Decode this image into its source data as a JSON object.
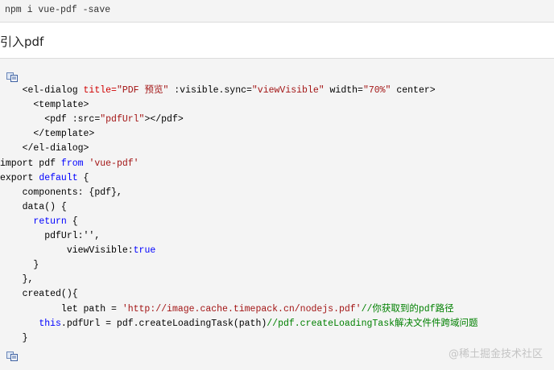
{
  "install": {
    "command": "npm i vue-pdf -save"
  },
  "heading": "引入pdf",
  "code": {
    "copy_icon_top": "copy-code-icon",
    "copy_icon_bottom": "copy-code-icon",
    "lines": [
      [
        {
          "t": "    <el-dialog "
        },
        {
          "t": "title=",
          "c": "attr"
        },
        {
          "t": "\"PDF 预览\"",
          "c": "str"
        },
        {
          "t": " :visible.sync="
        },
        {
          "t": "\"viewVisible\"",
          "c": "str"
        },
        {
          "t": " width="
        },
        {
          "t": "\"70%\"",
          "c": "str"
        },
        {
          "t": " center>"
        }
      ],
      [
        {
          "t": "      <template>"
        }
      ],
      [
        {
          "t": "        <pdf :src="
        },
        {
          "t": "\"pdfUrl\"",
          "c": "str"
        },
        {
          "t": "></pdf>"
        }
      ],
      [
        {
          "t": "      </template>"
        }
      ],
      [
        {
          "t": "    </el-dialog>"
        }
      ],
      [
        {
          "t": "import pdf "
        },
        {
          "t": "from",
          "c": "kw"
        },
        {
          "t": " "
        },
        {
          "t": "'vue-pdf'",
          "c": "str"
        }
      ],
      [
        {
          "t": "export "
        },
        {
          "t": "default",
          "c": "kw"
        },
        {
          "t": " {"
        }
      ],
      [
        {
          "t": "    components: {pdf},"
        }
      ],
      [
        {
          "t": "    data() {"
        }
      ],
      [
        {
          "t": "      "
        },
        {
          "t": "return",
          "c": "kw"
        },
        {
          "t": " {"
        }
      ],
      [
        {
          "t": "        pdfUrl:'',"
        }
      ],
      [
        {
          "t": "            viewVisible:"
        },
        {
          "t": "true",
          "c": "kw"
        }
      ],
      [
        {
          "t": "      }"
        }
      ],
      [
        {
          "t": "    },"
        }
      ],
      [
        {
          "t": "    created(){"
        }
      ],
      [
        {
          "t": "           let path = "
        },
        {
          "t": "'http://image.cache.timepack.cn/nodejs.pdf'",
          "c": "str"
        },
        {
          "t": "//你获取到的pdf路径",
          "c": "cmt"
        }
      ],
      [
        {
          "t": "       "
        },
        {
          "t": "this",
          "c": "kw"
        },
        {
          "t": ".pdfUrl = pdf.createLoadingTask(path)"
        },
        {
          "t": "//pdf.createLoadingTask解决文件件跨域问题",
          "c": "cmt"
        }
      ],
      [
        {
          "t": "    }"
        }
      ]
    ]
  },
  "watermark": "@稀土掘金技术社区"
}
